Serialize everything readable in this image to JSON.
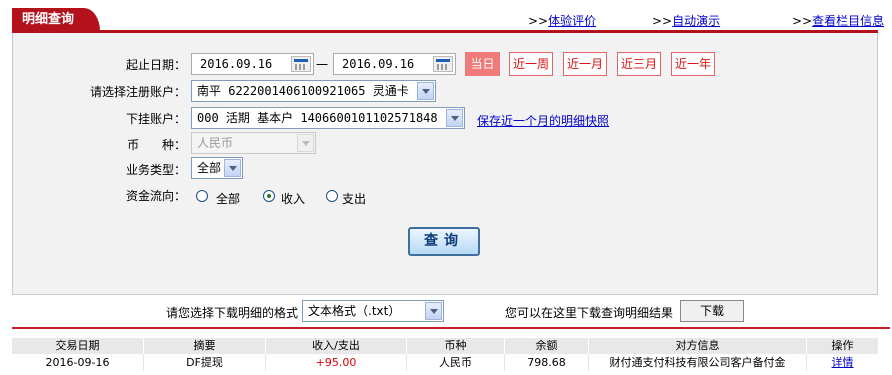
{
  "tab": {
    "title": "明细查询"
  },
  "top_links": {
    "eval": "体验评价",
    "auto": "自动演示",
    "info": "查看栏目信息",
    "prefix": ">>"
  },
  "form": {
    "date_label": "起止日期：",
    "start_date": "2016.09.16",
    "separator": "一",
    "end_date": "2016.09.16",
    "quick_ranges": [
      "当日",
      "近一周",
      "近一月",
      "近三月",
      "近一年"
    ],
    "account_label": "请选择注册账户：",
    "account_value": "南平  6222001406100921065 灵通卡",
    "sub_account_label": "下挂账户：",
    "sub_account_value": "000 活期 基本户 1406600101102571848",
    "save_snapshot_link": "保存近一个月的明细快照",
    "currency_label": "币      种：",
    "currency_value": "人民币",
    "biz_type_label": "业务类型：",
    "biz_type_value": "全部",
    "flow_label": "资金流向：",
    "flow_options": [
      "全部",
      "收入",
      "支出"
    ],
    "flow_selected": "收入",
    "query_button": "查询"
  },
  "download": {
    "format_label": "请您选择下载明细的格式",
    "format_value": "文本格式（.txt）",
    "hint": "您可以在这里下载查询明细结果",
    "button": "下载"
  },
  "table": {
    "headers": [
      "交易日期",
      "摘要",
      "收入/支出",
      "币种",
      "余额",
      "对方信息",
      "操作"
    ],
    "rows": [
      {
        "date": "2016-09-16",
        "summary": "DF提现",
        "amount": "+95.00",
        "currency": "人民币",
        "balance": "798.68",
        "counterparty": "财付通支付科技有限公司客户备付金",
        "action": "详情"
      }
    ]
  },
  "colors": {
    "brand_red": "#b3121d",
    "quick_active": "#f17a7a",
    "amount_red": "#e00000",
    "link_blue": "#0000cc"
  }
}
